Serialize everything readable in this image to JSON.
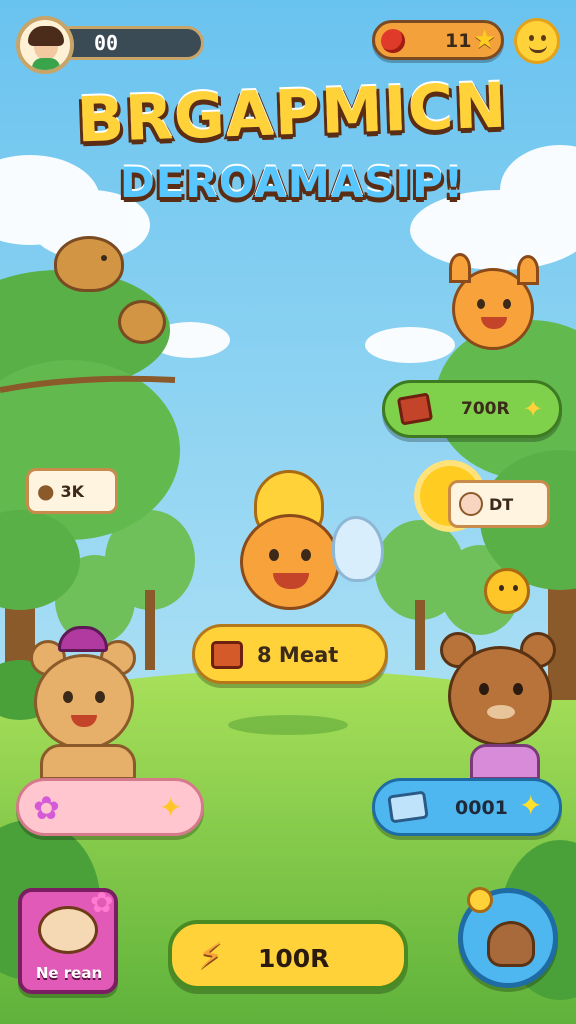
{
  "hud": {
    "left_counter": "00",
    "right_counter": "11"
  },
  "title": {
    "line1": "BRGAPMICN",
    "line2": "DEROAMASIP!"
  },
  "badges": {
    "left_chip": "3K",
    "right_chip": "DT"
  },
  "buttons": {
    "shop_top_right": "700R",
    "center_main": "8 Meat",
    "right_blue": "0001",
    "bottom_main": "100R",
    "bottom_left_label": "Ne rean"
  },
  "colors": {
    "sky": "#8fd3f0",
    "grass": "#7cc84a",
    "green_button": "#7fd04b",
    "yellow_button": "#ffd23a",
    "pink_bar": "#ffc6cf",
    "blue_button": "#4fb7f0"
  }
}
